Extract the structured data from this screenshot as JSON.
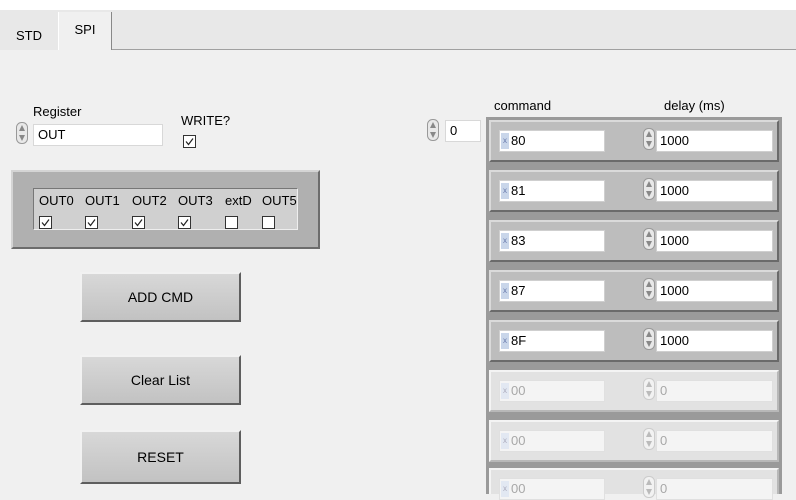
{
  "tabs": [
    {
      "label": "STD",
      "active": false
    },
    {
      "label": "SPI",
      "active": true
    }
  ],
  "register": {
    "label": "Register",
    "value": "OUT"
  },
  "write": {
    "label": "WRITE?",
    "checked": true
  },
  "outputs": [
    {
      "label": "OUT0",
      "checked": true
    },
    {
      "label": "OUT1",
      "checked": true
    },
    {
      "label": "OUT2",
      "checked": true
    },
    {
      "label": "OUT3",
      "checked": true
    },
    {
      "label": "extD",
      "checked": false
    },
    {
      "label": "OUT5",
      "checked": false
    }
  ],
  "buttons": {
    "add_cmd": "ADD CMD",
    "clear_list": "Clear List",
    "reset": "RESET"
  },
  "array_index": "0",
  "columns": {
    "command": "command",
    "delay": "delay (ms)"
  },
  "rows": [
    {
      "command": "80",
      "delay": "1000",
      "enabled": true
    },
    {
      "command": "81",
      "delay": "1000",
      "enabled": true
    },
    {
      "command": "83",
      "delay": "1000",
      "enabled": true
    },
    {
      "command": "87",
      "delay": "1000",
      "enabled": true
    },
    {
      "command": "8F",
      "delay": "1000",
      "enabled": true
    },
    {
      "command": "00",
      "delay": "0",
      "enabled": false
    },
    {
      "command": "00",
      "delay": "0",
      "enabled": false
    },
    {
      "command": "00",
      "delay": "0",
      "enabled": false
    }
  ],
  "radix_glyph": "x",
  "colors": {
    "frame": "#b0b0b0",
    "panel": "#f0f0f0"
  }
}
